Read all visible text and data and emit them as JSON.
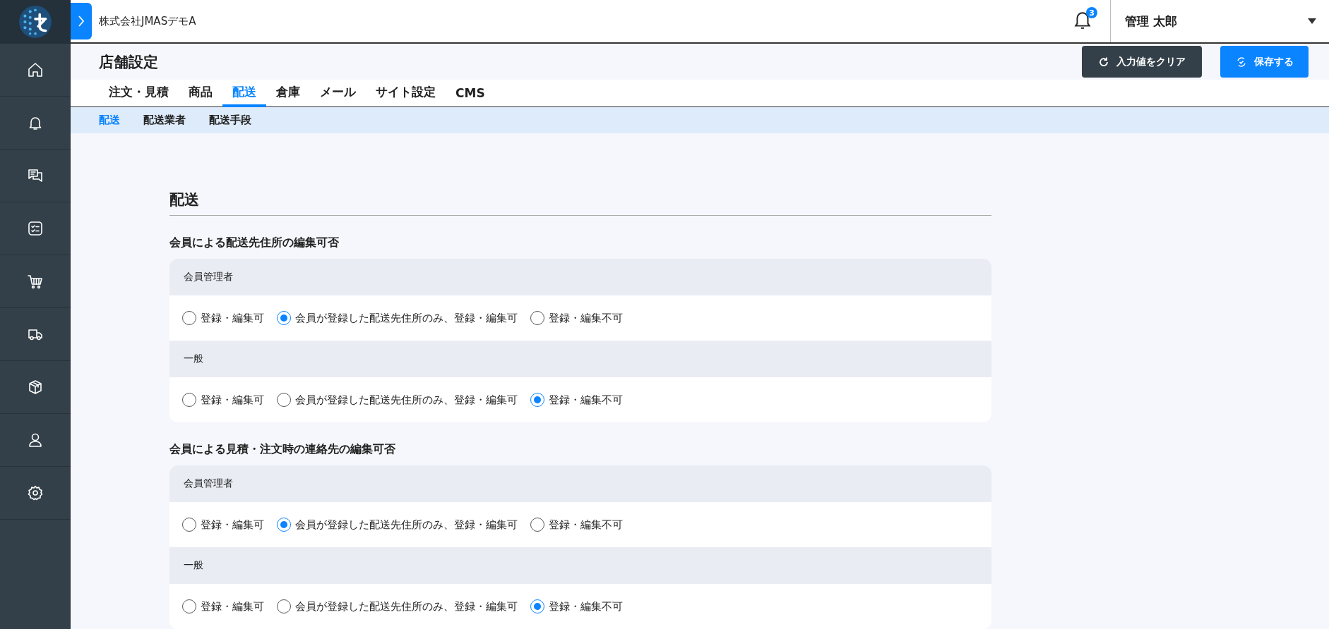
{
  "header": {
    "company": "株式会社JMASデモA",
    "notification_count": "3",
    "user": "管理 太郎"
  },
  "page": {
    "title": "店舗設定",
    "buttons": [
      {
        "label": "入力値をクリア",
        "kind": "clear"
      },
      {
        "label": "保存する",
        "kind": "save"
      }
    ]
  },
  "tabs": [
    {
      "label": "注文・見積",
      "selected": false
    },
    {
      "label": "商品",
      "selected": false
    },
    {
      "label": "配送",
      "selected": true
    },
    {
      "label": "倉庫",
      "selected": false
    },
    {
      "label": "メール",
      "selected": false
    },
    {
      "label": "サイト設定",
      "selected": false
    },
    {
      "label": "CMS",
      "selected": false
    }
  ],
  "subtabs": [
    {
      "label": "配送",
      "selected": true
    },
    {
      "label": "配送業者",
      "selected": false
    },
    {
      "label": "配送手段",
      "selected": false
    }
  ],
  "section": {
    "title": "配送",
    "groups": [
      {
        "title": "会員による配送先住所の編集可否",
        "rows": [
          {
            "label": "会員管理者",
            "options": [
              {
                "label": "登録・編集可",
                "selected": false
              },
              {
                "label": "会員が登録した配送先住所のみ、登録・編集可",
                "selected": true
              },
              {
                "label": "登録・編集不可",
                "selected": false
              }
            ]
          },
          {
            "label": "一般",
            "options": [
              {
                "label": "登録・編集可",
                "selected": false
              },
              {
                "label": "会員が登録した配送先住所のみ、登録・編集可",
                "selected": false
              },
              {
                "label": "登録・編集不可",
                "selected": true
              }
            ]
          }
        ]
      },
      {
        "title": "会員による見積・注文時の連絡先の編集可否",
        "rows": [
          {
            "label": "会員管理者",
            "options": [
              {
                "label": "登録・編集可",
                "selected": false
              },
              {
                "label": "会員が登録した配送先住所のみ、登録・編集可",
                "selected": true
              },
              {
                "label": "登録・編集不可",
                "selected": false
              }
            ]
          },
          {
            "label": "一般",
            "options": [
              {
                "label": "登録・編集可",
                "selected": false
              },
              {
                "label": "会員が登録した配送先住所のみ、登録・編集可",
                "selected": false
              },
              {
                "label": "登録・編集不可",
                "selected": true
              }
            ]
          }
        ]
      }
    ]
  }
}
